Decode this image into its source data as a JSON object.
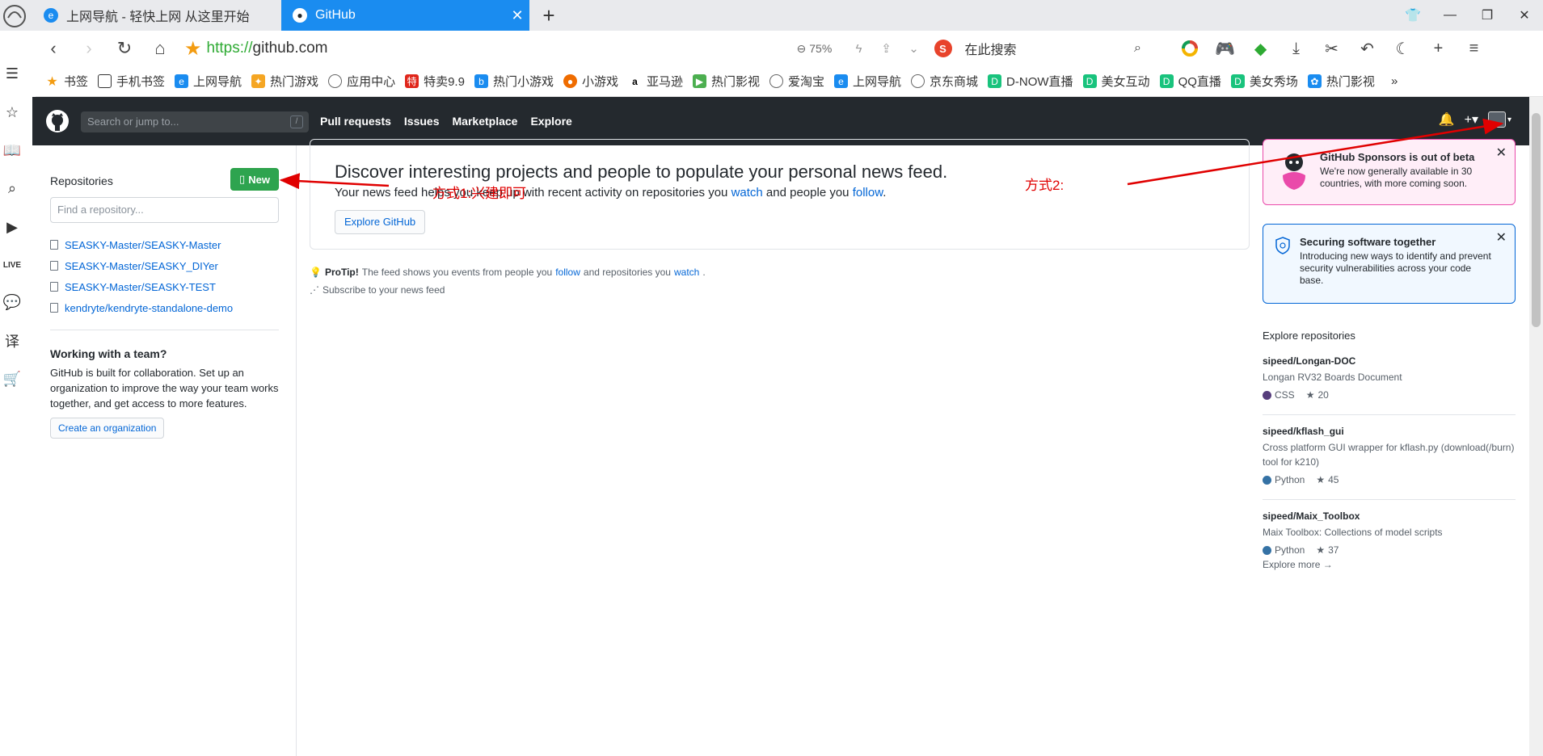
{
  "browser": {
    "tabs": [
      {
        "title": "上网导航 - 轻快上网 从这里开始",
        "active": false
      },
      {
        "title": "GitHub",
        "active": true
      }
    ],
    "url_scheme": "https://",
    "url_host": "github.com",
    "zoom": "75%",
    "search_placeholder": "在此搜索",
    "bookmarks": [
      "书签",
      "手机书签",
      "上网导航",
      "热门游戏",
      "应用中心",
      "特卖9.9",
      "热门小游戏",
      "小游戏",
      "亚马逊",
      "热门影视",
      "爱淘宝",
      "上网导航",
      "京东商城",
      "D-NOW直播",
      "美女互动",
      "QQ直播",
      "美女秀场",
      "热门影视"
    ]
  },
  "github": {
    "search_placeholder": "Search or jump to...",
    "search_shortcut": "/",
    "nav": [
      "Pull requests",
      "Issues",
      "Marketplace",
      "Explore"
    ],
    "sidebar": {
      "title": "Repositories",
      "new_button": "New",
      "find_placeholder": "Find a repository...",
      "repos": [
        "SEASKY-Master/SEASKY-Master",
        "SEASKY-Master/SEASKY_DIYer",
        "SEASKY-Master/SEASKY-TEST",
        "kendryte/kendryte-standalone-demo"
      ],
      "team_title": "Working with a team?",
      "team_text": "GitHub is built for collaboration. Set up an organization to improve the way your team works together, and get access to more features.",
      "org_button": "Create an organization"
    },
    "feed": {
      "title": "Discover interesting projects and people to populate your personal news feed.",
      "sub_prefix": "Your news feed helps you keep up with recent activity on repositories you ",
      "sub_watch": "watch",
      "sub_mid": " and people you ",
      "sub_follow": "follow",
      "sub_end": ".",
      "explore_button": "Explore GitHub",
      "protip_label": "ProTip!",
      "protip_text": " The feed shows you events from people you ",
      "protip_follow": "follow",
      "protip_mid": " and repositories you ",
      "protip_watch": "watch",
      "protip_end": ".",
      "subscribe": "Subscribe to your news feed"
    },
    "right": {
      "sponsors_title": "GitHub Sponsors is out of beta",
      "sponsors_body": "We're now generally available in 30 countries, with more coming soon.",
      "security_title": "Securing software together",
      "security_body": "Introducing new ways to identify and prevent security vulnerabilities across your code base.",
      "explore_title": "Explore repositories",
      "repos": [
        {
          "name": "sipeed/Longan-DOC",
          "desc": "Longan RV32 Boards Document",
          "lang": "CSS",
          "lang_color": "#563d7c",
          "stars": "20"
        },
        {
          "name": "sipeed/kflash_gui",
          "desc": "Cross platform GUI wrapper for kflash.py (download(/burn) tool for k210)",
          "lang": "Python",
          "lang_color": "#3572A5",
          "stars": "45"
        },
        {
          "name": "sipeed/Maix_Toolbox",
          "desc": "Maix Toolbox: Collections of model scripts",
          "lang": "Python",
          "lang_color": "#3572A5",
          "stars": "37"
        }
      ],
      "explore_more": "Explore more →"
    }
  },
  "annotations": {
    "method1": "方式1:兴建即可",
    "method2": "方式2:"
  }
}
